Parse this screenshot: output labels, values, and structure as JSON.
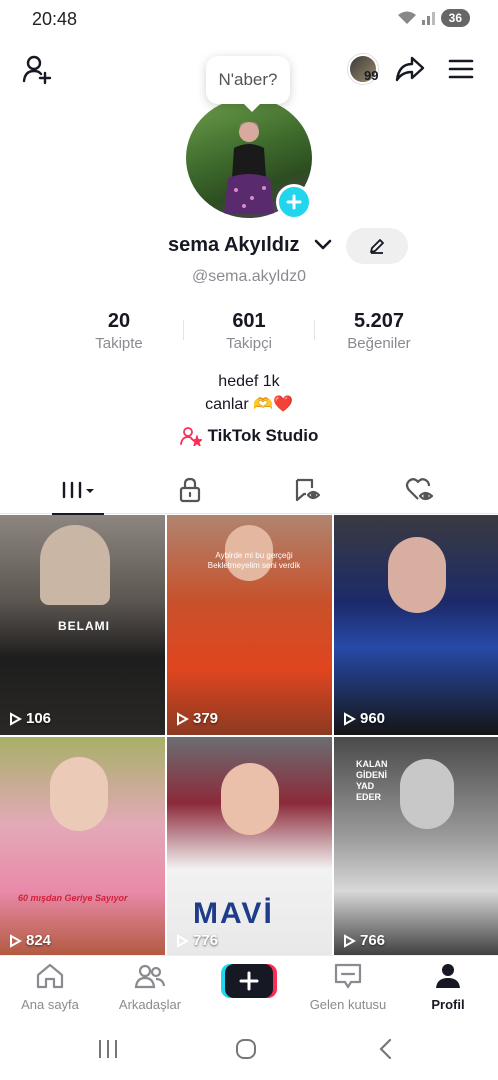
{
  "status": {
    "time": "20:48",
    "battery": "36"
  },
  "header": {
    "story_count": "99"
  },
  "bubble": {
    "text": "N'aber?"
  },
  "profile": {
    "name": "sema Akyıldız",
    "handle": "@sema.akyldz0",
    "bio_line1": "hedef 1k",
    "bio_line2": "canlar 🫶❤️",
    "studio_label": "TikTok Studio"
  },
  "stats": [
    {
      "value": "20",
      "label": "Takipte"
    },
    {
      "value": "601",
      "label": "Takipçi"
    },
    {
      "value": "5.207",
      "label": "Beğeniler"
    }
  ],
  "videos": [
    {
      "views": "106",
      "caption": "BELAMI"
    },
    {
      "views": "379",
      "caption": "Aybirde mi bu gerçeği Bekletmeyelim seni verdik"
    },
    {
      "views": "960",
      "caption": ""
    },
    {
      "views": "824",
      "caption": "60 mışdan Geriye Sayıyor"
    },
    {
      "views": "776",
      "caption": "MAVİ"
    },
    {
      "views": "766",
      "caption": "KALAN GİDENİ YAD EDER"
    }
  ],
  "nav": {
    "home": "Ana sayfa",
    "friends": "Arkadaşlar",
    "inbox": "Gelen kutusu",
    "profile": "Profil"
  },
  "colors": {
    "accent_cyan": "#20d5ec",
    "accent_red": "#fe2c55",
    "studio_pink": "#fe2c55"
  }
}
